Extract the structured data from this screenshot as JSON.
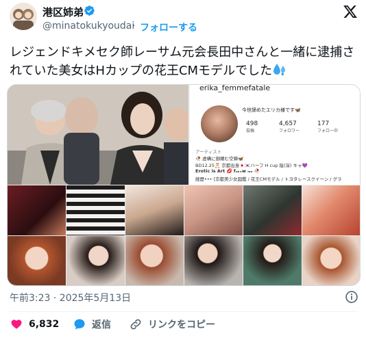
{
  "author": {
    "name": "港区姉弟",
    "handle": "@minatokukyoudai",
    "follow_label": "フォローする",
    "separator": "·"
  },
  "tweet": {
    "text": "レジェンドキメセク師レーサム元会長田中さんと一緒に逮捕されていた美女はHカップの花王CMモデルでした"
  },
  "media": {
    "instagram": {
      "username": "erika_femmefatale",
      "display_name": "今世諦めたエリカ様です🦋",
      "stats": [
        {
          "value": "498",
          "label": "投稿"
        },
        {
          "value": "4,657",
          "label": "フォロワー"
        },
        {
          "value": "177",
          "label": "フォロー中"
        }
      ],
      "category": "アーティスト",
      "bio_lines": [
        "🥀 虚構に御嬢む空蝉🦋",
        "BD12.25🎅 京都出身🇯🇵🇰🇷ハーフ H cup 陰(深) キャ💜",
        "Erotic is Art 💋  fₐₖₑw ₘₑ 🥀",
        "経歴••• [京都美少女図鑑 / 花王CMモデル / トヨタレースクイーン / グラ"
      ]
    }
  },
  "timestamp": "午前3:23 · 2025年5月13日",
  "actions": {
    "like_count": "6,832",
    "reply_label": "返信",
    "copy_link_label": "リンクをコピー"
  },
  "colors": {
    "accent": "#1d9bf0",
    "like": "#f91880",
    "text": "#0f1419",
    "muted": "#536471"
  },
  "icons": [
    "verified-badge-icon",
    "x-logo-icon",
    "droplets-emoji-icon",
    "info-icon",
    "heart-icon",
    "reply-icon",
    "link-icon"
  ]
}
